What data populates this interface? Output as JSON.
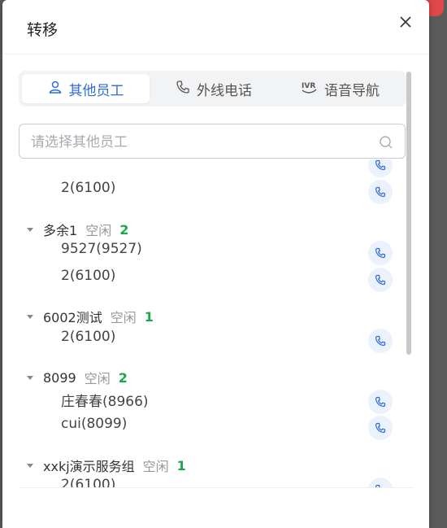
{
  "dialog": {
    "title": "转移"
  },
  "tabs": [
    {
      "label": "其他员工",
      "icon": "user-icon",
      "active": true
    },
    {
      "label": "外线电话",
      "icon": "phone-icon",
      "active": false
    },
    {
      "label": "语音导航",
      "icon": "ivr-icon",
      "active": false
    }
  ],
  "search": {
    "placeholder": "请选择其他员工",
    "value": ""
  },
  "list": {
    "top_members": [
      {
        "label": "2(6100)"
      }
    ],
    "groups": [
      {
        "name": "多余1",
        "status": "空闲",
        "count": "2",
        "members": [
          "9527(9527)",
          "2(6100)"
        ]
      },
      {
        "name": "6002测试",
        "status": "空闲",
        "count": "1",
        "members": [
          "2(6100)"
        ]
      },
      {
        "name": "8099",
        "status": "空闲",
        "count": "2",
        "members": [
          "庄春春(8966)",
          "cui(8099)"
        ]
      },
      {
        "name": "xxkj演示服务组",
        "status": "空闲",
        "count": "1",
        "members": [
          "2(6100)"
        ]
      }
    ]
  },
  "colors": {
    "accent": "#2f6bd8",
    "count": "#1aa84a"
  }
}
